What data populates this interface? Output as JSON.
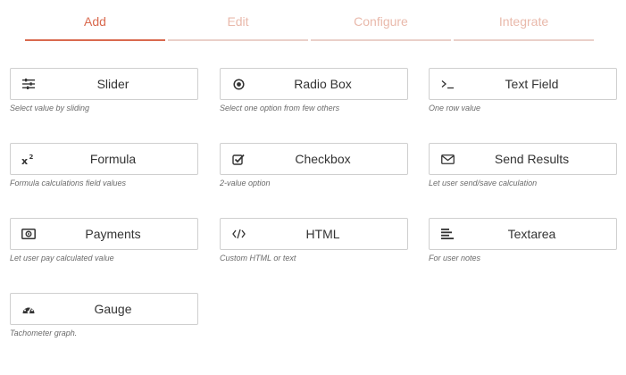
{
  "tabs": [
    {
      "label": "Add",
      "active": true
    },
    {
      "label": "Edit",
      "active": false
    },
    {
      "label": "Configure",
      "active": false
    },
    {
      "label": "Integrate",
      "active": false
    }
  ],
  "fields": [
    {
      "label": "Slider",
      "description": "Select value by sliding",
      "icon": "sliders-icon"
    },
    {
      "label": "Radio Box",
      "description": "Select one option from few others",
      "icon": "radio-icon"
    },
    {
      "label": "Text Field",
      "description": "One row value",
      "icon": "terminal-icon"
    },
    {
      "label": "Formula",
      "description": "Formula calculations field values",
      "icon": "superscript-icon"
    },
    {
      "label": "Checkbox",
      "description": "2-value option",
      "icon": "checkbox-icon"
    },
    {
      "label": "Send Results",
      "description": "Let user send/save calculation",
      "icon": "envelope-icon"
    },
    {
      "label": "Payments",
      "description": "Let user pay calculated value",
      "icon": "money-icon"
    },
    {
      "label": "HTML",
      "description": "Custom HTML or text",
      "icon": "code-icon"
    },
    {
      "label": "Textarea",
      "description": "For user notes",
      "icon": "align-left-icon"
    },
    {
      "label": "Gauge",
      "description": "Tachometer graph.",
      "icon": "gauge-icon"
    }
  ],
  "colors": {
    "accent": "#d96a4f",
    "inactive_tab": "#e9b9ab",
    "border": "#cfcfcf"
  }
}
